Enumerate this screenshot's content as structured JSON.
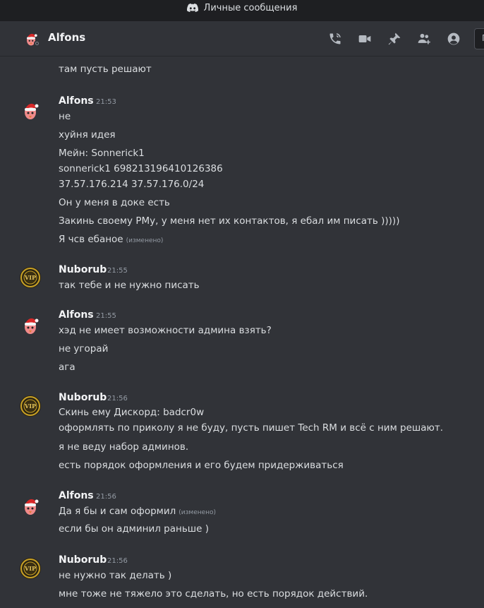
{
  "app": {
    "title": "Личные сообщения"
  },
  "header": {
    "username": "Alfons",
    "icons": [
      "phone-call-icon",
      "video-call-icon",
      "pin-icon",
      "add-friend-icon",
      "user-profile-icon"
    ]
  },
  "colors": {
    "background": "#313338",
    "titlebar": "#1e1f22",
    "text": "#dbdee1",
    "muted": "#949ba4",
    "vip_gold": "#c9a227"
  },
  "messages": {
    "partial_first_line": "там пусть решают",
    "groups": [
      {
        "author": "Alfons",
        "time": "21:53",
        "avatar": "santa-bird-avatar",
        "lines": [
          {
            "text": "не"
          },
          {
            "text": "хуйня идея"
          },
          {
            "text": "Мейн: Sonnerick1"
          },
          {
            "text": " sonnerick1 698213196410126386"
          },
          {
            "text": "37.57.176.214 37.57.176.0/24"
          },
          {
            "text": "Он у меня в доке есть"
          },
          {
            "text": "Закинь своему РМу, у меня нет их контактов, я ебал им писать )))))"
          },
          {
            "text": "Я чсв ебаное",
            "edited": "(изменено)"
          }
        ]
      },
      {
        "author": "Nuborub",
        "time": "21:55",
        "avatar": "vip-badge-avatar",
        "lines": [
          {
            "text": "так тебе и не нужно писать"
          }
        ]
      },
      {
        "author": "Alfons",
        "time": "21:55",
        "avatar": "santa-bird-avatar",
        "lines": [
          {
            "text": "хэд не имеет возможности админа взять?"
          },
          {
            "text": "не угорай"
          },
          {
            "text": "ага"
          }
        ]
      },
      {
        "author": "Nuborub",
        "time": "21:56",
        "avatar": "vip-badge-avatar",
        "lines": [
          {
            "text": "Скинь ему Дискорд: badcr0w"
          },
          {
            "text": "оформлять по приколу я не буду, пусть пишет Tech RM и всё с ним решают."
          },
          {
            "text": "я не веду набор админов."
          },
          {
            "text": "есть порядок оформления и его будем придерживаться"
          }
        ]
      },
      {
        "author": "Alfons",
        "time": "21:56",
        "avatar": "santa-bird-avatar",
        "lines": [
          {
            "text": "Да я бы и сам оформил",
            "edited": "(изменено)"
          },
          {
            "text": "если бы он админил раньше )"
          }
        ]
      },
      {
        "author": "Nuborub",
        "time": "21:56",
        "avatar": "vip-badge-avatar",
        "lines": [
          {
            "text": "не нужно так делать )"
          },
          {
            "text": "мне тоже не тяжело это сделать, но есть порядок действий."
          }
        ]
      }
    ]
  }
}
